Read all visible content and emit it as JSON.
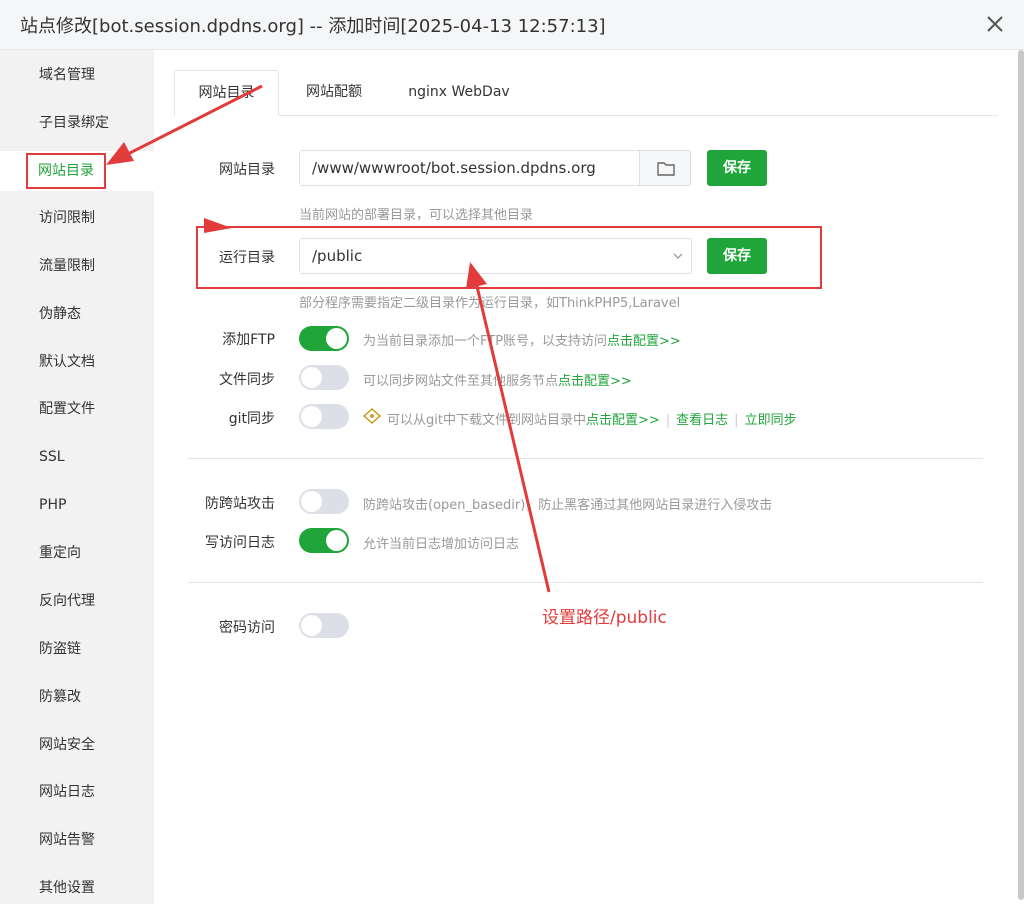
{
  "window": {
    "title": "站点修改[bot.session.dpdns.org] -- 添加时间[2025-04-13 12:57:13]"
  },
  "sidebar": {
    "items": [
      {
        "label": "域名管理"
      },
      {
        "label": "子目录绑定"
      },
      {
        "label": "网站目录"
      },
      {
        "label": "访问限制"
      },
      {
        "label": "流量限制"
      },
      {
        "label": "伪静态"
      },
      {
        "label": "默认文档"
      },
      {
        "label": "配置文件"
      },
      {
        "label": "SSL"
      },
      {
        "label": "PHP"
      },
      {
        "label": "重定向"
      },
      {
        "label": "反向代理"
      },
      {
        "label": "防盗链"
      },
      {
        "label": "防篡改"
      },
      {
        "label": "网站安全"
      },
      {
        "label": "网站日志"
      },
      {
        "label": "网站告警"
      },
      {
        "label": "其他设置"
      }
    ],
    "active_index": 2
  },
  "tabs": [
    {
      "label": "网站目录"
    },
    {
      "label": "网站配额"
    },
    {
      "label": "nginx WebDav"
    }
  ],
  "site_dir": {
    "label": "网站目录",
    "value": "/www/wwwroot/bot.session.dpdns.org",
    "save": "保存",
    "hint": "当前网站的部署目录，可以选择其他目录"
  },
  "run_dir": {
    "label": "运行目录",
    "value": "/public",
    "save": "保存",
    "hint": "部分程序需要指定二级目录作为运行目录，如ThinkPHP5,Laravel"
  },
  "ftp": {
    "label": "添加FTP",
    "on": true,
    "desc": "为当前目录添加一个FTP账号，以支持访问",
    "link": "点击配置>>"
  },
  "file_sync": {
    "label": "文件同步",
    "on": false,
    "desc": "可以同步网站文件至其他服务节点",
    "link": "点击配置>>"
  },
  "git_sync": {
    "label": "git同步",
    "on": false,
    "desc": "可以从git中下载文件到网站目录中",
    "link": "点击配置>>",
    "view_log": "查看日志",
    "sync_now": "立即同步"
  },
  "anti_xss": {
    "label": "防跨站攻击",
    "on": false,
    "desc": "防跨站攻击(open_basedir)，防止黑客通过其他网站目录进行入侵攻击"
  },
  "access_log": {
    "label": "写访问日志",
    "on": true,
    "desc": "允许当前日志增加访问日志"
  },
  "password_access": {
    "label": "密码访问",
    "on": false
  },
  "annotation": {
    "text": "设置路径/public"
  },
  "colors": {
    "accent": "#20a53a",
    "annotation": "#e23b3b"
  }
}
